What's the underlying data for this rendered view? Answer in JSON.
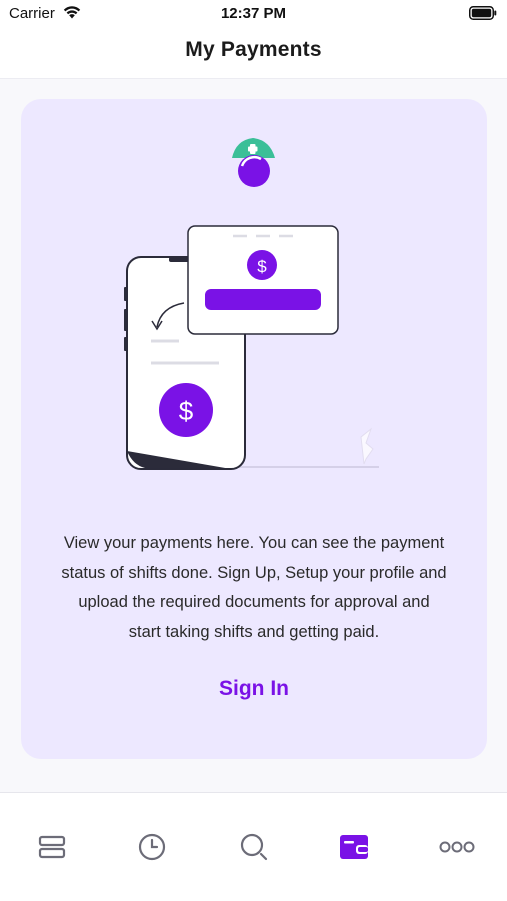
{
  "status_bar": {
    "carrier": "Carrier",
    "time": "12:37 PM",
    "wifi_icon": "wifi-icon",
    "battery_icon": "battery-full-icon"
  },
  "header": {
    "title": "My Payments"
  },
  "empty_state": {
    "logo_icon": "nurse-cap-logo-icon",
    "illustration": "phone-payment-illustration",
    "description": "View your payments here. You can see the payment status of shifts done. Sign Up, Setup your profile and upload the required documents for approval and start taking shifts and getting paid.",
    "sign_in_label": "Sign In"
  },
  "tab_bar": {
    "active_tab": "payments",
    "tabs": [
      {
        "id": "shifts",
        "icon": "list-icon"
      },
      {
        "id": "history",
        "icon": "clock-icon"
      },
      {
        "id": "search",
        "icon": "search-icon"
      },
      {
        "id": "payments",
        "icon": "wallet-icon"
      },
      {
        "id": "more",
        "icon": "more-icon"
      }
    ]
  },
  "colors": {
    "accent": "#7a12e6",
    "card_background": "#ede8ff",
    "logo_teal": "#3bbf98",
    "tab_inactive": "#6c6c78"
  }
}
